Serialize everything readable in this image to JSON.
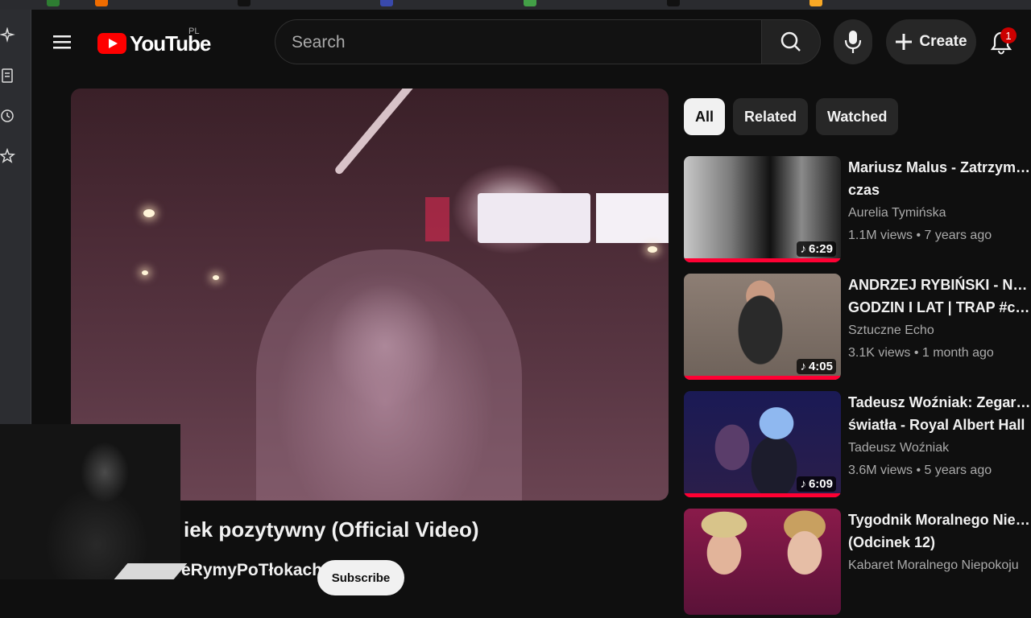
{
  "masthead": {
    "logo_text": "YouTube",
    "country_code": "PL",
    "search_placeholder": "Search",
    "create_label": "Create",
    "notification_count": "1"
  },
  "video": {
    "title": "iek pozytywny (Official Video)",
    "channel": "eRymyPoTłokach",
    "subscribe_label": "Subscribe"
  },
  "chips": [
    {
      "label": "All",
      "active": true
    },
    {
      "label": "Related",
      "active": false
    },
    {
      "label": "Watched",
      "active": false
    }
  ],
  "recommendations": [
    {
      "title_line1": "Mariusz Malus - Zatrzymany",
      "title_line2": "czas",
      "channel": "Aurelia Tymińska",
      "meta": "1.1M views • 7 years ago",
      "duration": "6:29",
      "progress": 1.0
    },
    {
      "title_line1": "ANDRZEJ RYBIŃSKI - NIE LICZE",
      "title_line2": "GODZIN I LAT | TRAP #coverai...",
      "channel": "Sztuczne Echo",
      "meta": "3.1K views • 1 month ago",
      "duration": "4:05",
      "progress": 1.0
    },
    {
      "title_line1": "Tadeusz Woźniak: Zegarmistrz",
      "title_line2": "światła - Royal Albert Hall",
      "channel": "Tadeusz Woźniak",
      "meta": "3.6M views • 5 years ago",
      "duration": "6:09",
      "progress": 1.0
    },
    {
      "title_line1": "Tygodnik Moralnego Niepokoju",
      "title_line2": "(Odcinek 12)",
      "channel": "Kabaret Moralnego Niepokoju",
      "meta": "",
      "duration": "",
      "progress": 0
    }
  ],
  "colors": {
    "background": "#0f0f0f",
    "accent_red": "#ff0033",
    "chip_bg": "#272727",
    "text_secondary": "#aaaaaa"
  }
}
